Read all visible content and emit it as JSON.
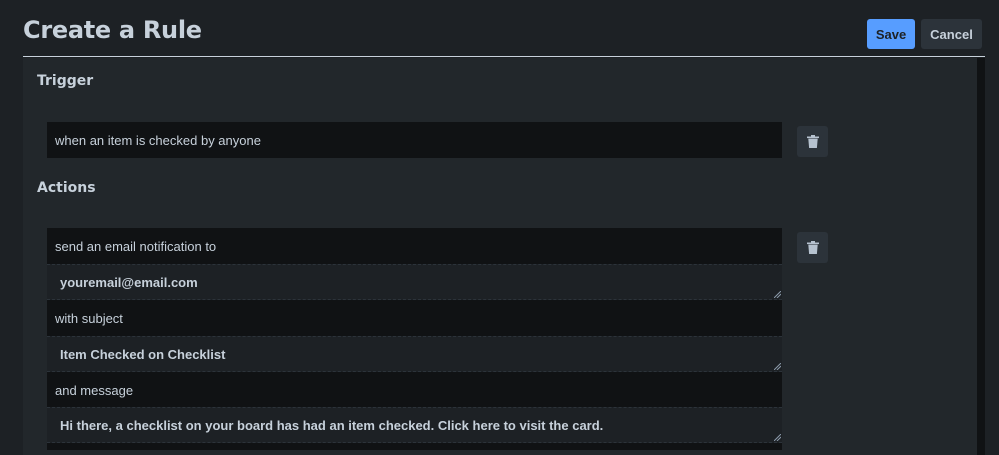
{
  "header": {
    "title": "Create a Rule",
    "save_label": "Save",
    "cancel_label": "Cancel"
  },
  "trigger": {
    "heading": "Trigger",
    "text": "when an item is checked by anyone"
  },
  "actions": {
    "heading": "Actions",
    "email_label": "send an email notification to",
    "email_value": "youremail@email.com",
    "subject_label": "with subject",
    "subject_value": "Item Checked on Checklist",
    "message_label": "and message",
    "message_value": "Hi there, a checklist on your board has had an item checked. Click here to visit the card."
  },
  "icons": {
    "trigger_delete": "trash-icon",
    "action_delete": "trash-icon"
  },
  "colors": {
    "background": "#1d2125",
    "accent": "#579dff",
    "field": "#101214"
  }
}
